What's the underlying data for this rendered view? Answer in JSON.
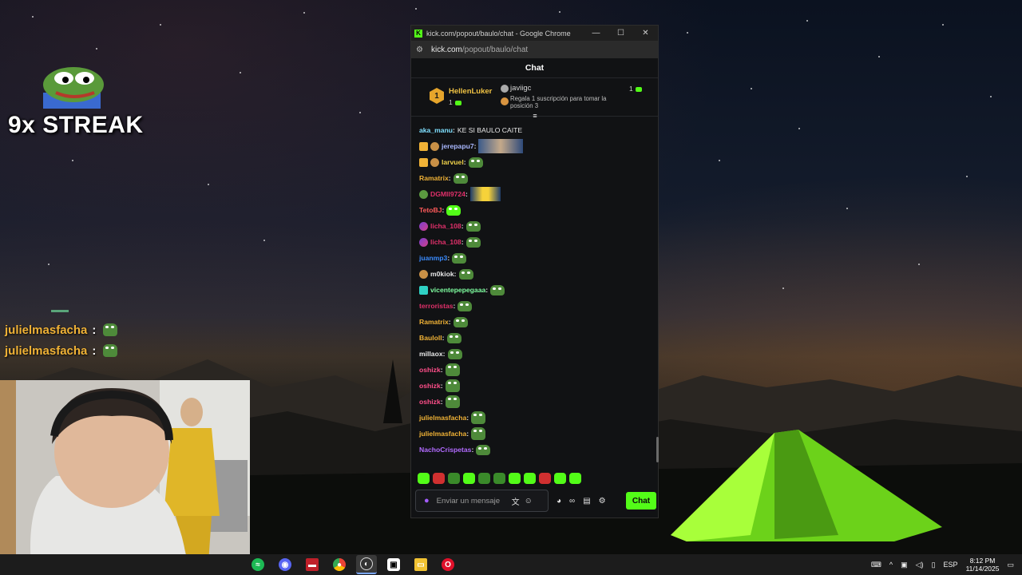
{
  "overlay": {
    "streak_text": "9x STREAK",
    "chat": [
      {
        "user": "julielmasfacha",
        "sep": ":"
      },
      {
        "user": "julielmasfacha",
        "sep": ":"
      }
    ]
  },
  "window": {
    "title": "kick.com/popout/baulo/chat - Google Chrome",
    "url_host": "kick.com",
    "url_path": "/popout/baulo/chat",
    "buttons": {
      "minimize": "—",
      "maximize": "☐",
      "close": "✕"
    }
  },
  "chat": {
    "header": "Chat",
    "pinned": {
      "rank": "1",
      "user1": "HellenLuker",
      "user1_count": "1",
      "user2": "javiigc",
      "promo": "Regala 1 suscripción para tomar la posición 3",
      "user2_count": "1"
    },
    "messages": [
      {
        "user": "aka_manu",
        "color": "#7fe0ff",
        "text": "KE SI BAULO CAITE"
      },
      {
        "user": "jerepapu7",
        "color": "#a9b8ff"
      },
      {
        "user": "larvuel",
        "color": "#f0d24a"
      },
      {
        "user": "Ramatrix",
        "color": "#f0b236"
      },
      {
        "user": "DGMII9724",
        "color": "#e0306a"
      },
      {
        "user": "TetoBJ",
        "color": "#ff5a5a"
      },
      {
        "user": "licha_108",
        "color": "#e0306a"
      },
      {
        "user": "licha_108",
        "color": "#e0306a"
      },
      {
        "user": "juanmp3",
        "color": "#3a8bff"
      },
      {
        "user": "m0kiok",
        "color": "#e8e8e8"
      },
      {
        "user": "vicentepepegaaa",
        "color": "#7fffa0"
      },
      {
        "user": "terroristas",
        "color": "#e0306a"
      },
      {
        "user": "Ramatrix",
        "color": "#f0b236"
      },
      {
        "user": "Bauloll",
        "color": "#f0b236"
      },
      {
        "user": "millaox",
        "color": "#e8e8e8"
      },
      {
        "user": "oshizk",
        "color": "#ff4f8a"
      },
      {
        "user": "oshizk",
        "color": "#ff4f8a"
      },
      {
        "user": "oshizk",
        "color": "#ff4f8a"
      },
      {
        "user": "julielmasfacha",
        "color": "#f0b236"
      },
      {
        "user": "julielmasfacha",
        "color": "#f0b236"
      },
      {
        "user": "NachoCrispetas",
        "color": "#b26bff"
      }
    ],
    "input_placeholder": "Enviar un mensaje",
    "send_label": "Chat",
    "accent": "#53fc18"
  },
  "taskbar": {
    "apps": [
      "spotify-icon",
      "discord-icon",
      "voicemeeter-icon",
      "chrome-icon",
      "obs-icon",
      "app-icon",
      "file-explorer-icon",
      "opera-icon"
    ],
    "lang": "ESP",
    "time": "8:12 PM",
    "date": "11/14/2025"
  }
}
